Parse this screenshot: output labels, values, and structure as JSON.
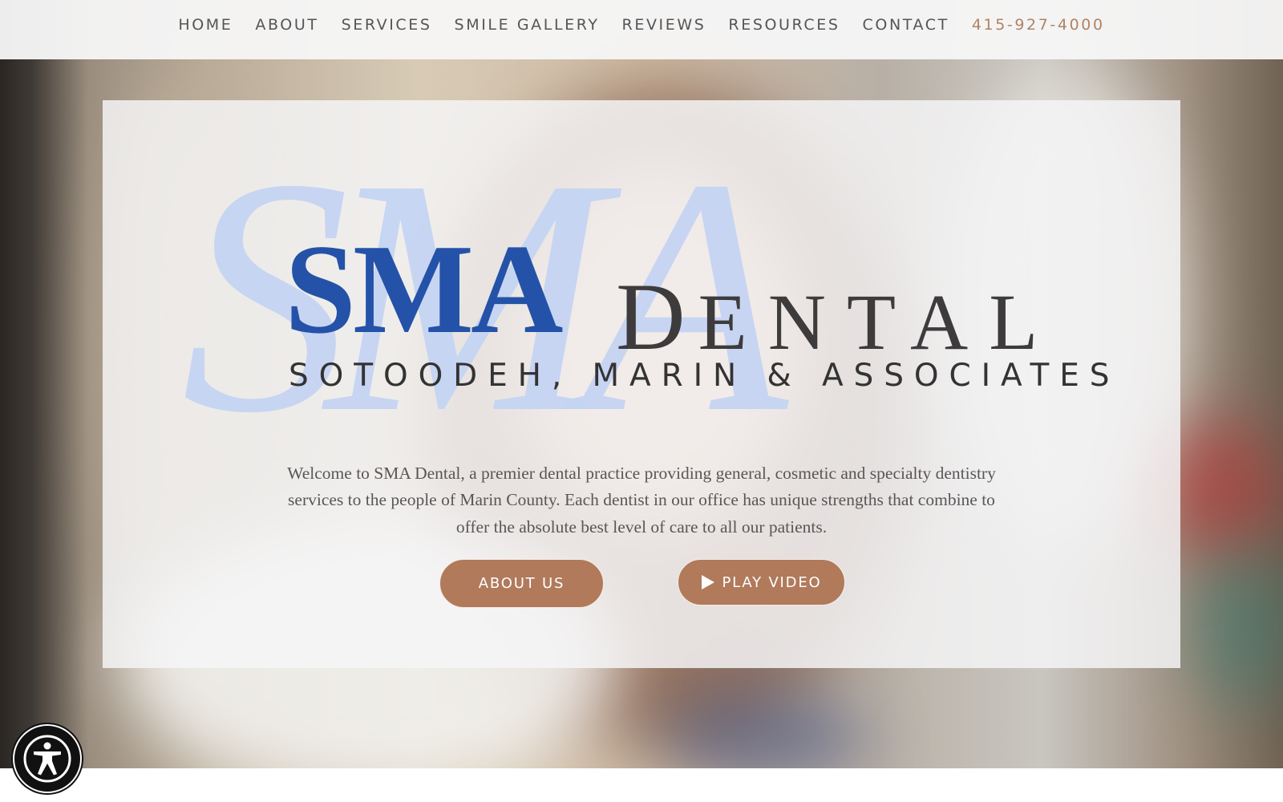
{
  "nav": {
    "items": [
      {
        "label": "HOME"
      },
      {
        "label": "ABOUT"
      },
      {
        "label": "SERVICES"
      },
      {
        "label": "SMILE GALLERY"
      },
      {
        "label": "REVIEWS"
      },
      {
        "label": "RESOURCES"
      },
      {
        "label": "CONTACT"
      }
    ],
    "phone": "415-927-4000"
  },
  "logo": {
    "sma": "SMA",
    "dental_initial": "D",
    "dental_rest": "ENTAL",
    "subtitle": "SOTOODEH, MARIN & ASSOCIATES",
    "monogram": "SMA"
  },
  "intro": {
    "text": "Welcome to SMA Dental, a premier dental practice providing general, cosmetic and specialty dentistry services to the people of Marin County. Each dentist in our office has unique strengths that combine to offer the absolute best level of care to all our patients."
  },
  "buttons": {
    "about_label": "ABOUT US",
    "video_label": "PLAY VIDEO",
    "video_icon": "play-icon"
  },
  "accessibility": {
    "icon": "accessibility-icon"
  },
  "colors": {
    "brand_blue": "#2452a8",
    "accent_copper": "#b07a5b",
    "phone_copper": "#b08365",
    "monogram_blue": "#c4d4f2",
    "nav_text": "#555555"
  }
}
